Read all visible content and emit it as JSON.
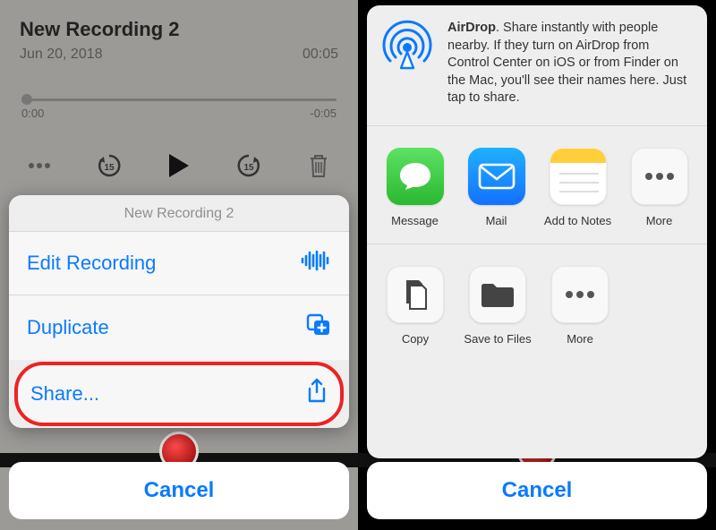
{
  "left": {
    "title": "New Recording 2",
    "date": "Jun 20, 2018",
    "duration": "00:05",
    "elapsed": "0:00",
    "remaining": "-0:05",
    "sheet_title": "New Recording 2",
    "actions": {
      "edit": "Edit Recording",
      "duplicate": "Duplicate",
      "share": "Share..."
    },
    "cancel": "Cancel"
  },
  "right": {
    "airdrop_bold": "AirDrop",
    "airdrop_text": ". Share instantly with people nearby. If they turn on AirDrop from Control Center on iOS or from Finder on the Mac, you'll see their names here. Just tap to share.",
    "apps": [
      "Message",
      "Mail",
      "Add to Notes",
      "More"
    ],
    "actions": [
      "Copy",
      "Save to Files",
      "More"
    ],
    "cancel": "Cancel"
  }
}
